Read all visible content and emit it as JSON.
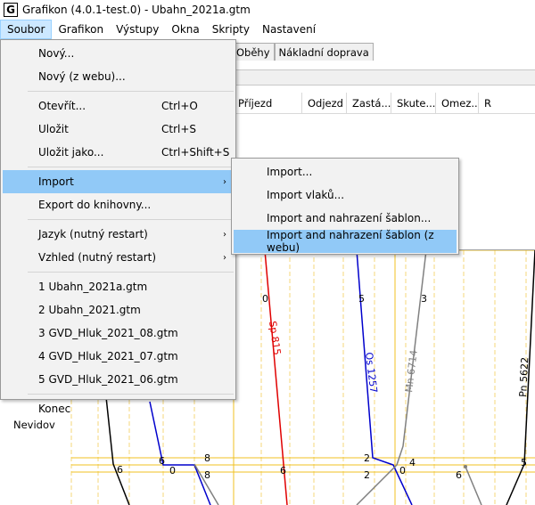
{
  "window": {
    "title": "Grafikon (4.0.1-test.0) - Ubahn_2021a.gtm",
    "icon_letter": "G"
  },
  "menubar": [
    "Soubor",
    "Grafikon",
    "Výstupy",
    "Okna",
    "Skripty",
    "Nastavení"
  ],
  "file_menu": {
    "items": [
      {
        "label": "Nový..."
      },
      {
        "label": "Nový (z webu)..."
      },
      {
        "label": "Otevřít...",
        "shortcut": "Ctrl+O"
      },
      {
        "label": "Uložit",
        "shortcut": "Ctrl+S"
      },
      {
        "label": "Uložit jako...",
        "shortcut": "Ctrl+Shift+S"
      },
      {
        "label": "Import"
      },
      {
        "label": "Export do knihovny..."
      },
      {
        "label": "Jazyk (nutný restart)"
      },
      {
        "label": "Vzhled (nutný restart)"
      },
      {
        "label": "1 Ubahn_2021a.gtm"
      },
      {
        "label": "2 Ubahn_2021.gtm"
      },
      {
        "label": "3 GVD_Hluk_2021_08.gtm"
      },
      {
        "label": "4 GVD_Hluk_2021_07.gtm"
      },
      {
        "label": "5 GVD_Hluk_2021_06.gtm"
      },
      {
        "label": "Konec"
      }
    ],
    "submenu_arrow": "›"
  },
  "import_submenu": [
    "Import...",
    "Import vlaků...",
    "Import and nahrazení šablon...",
    "Import and nahrazení šablon (z webu)"
  ],
  "background": {
    "tabs": [
      "Oběhy",
      "Nákladní doprava"
    ],
    "columns": [
      "Příjezd",
      "Odjezd",
      "Zastá...",
      "Skute...",
      "Omez...",
      "R"
    ],
    "station": "Nevidov",
    "train_labels": [
      "Sp 815",
      "Os 1257",
      "Mn 6714",
      "Pn 5622"
    ],
    "chart_numbers": [
      "0",
      "5",
      "3",
      "6",
      "8",
      "0",
      "8",
      "6",
      "2",
      "4",
      "2",
      "0",
      "6",
      "5",
      "6"
    ],
    "colors": {
      "sp": "#e00000",
      "os": "#0000cc",
      "mn": "#808080",
      "pn": "#000000",
      "station_line": "#f0c020",
      "hour_line": "#f5d77a",
      "highlight": "#91c9f7"
    }
  }
}
